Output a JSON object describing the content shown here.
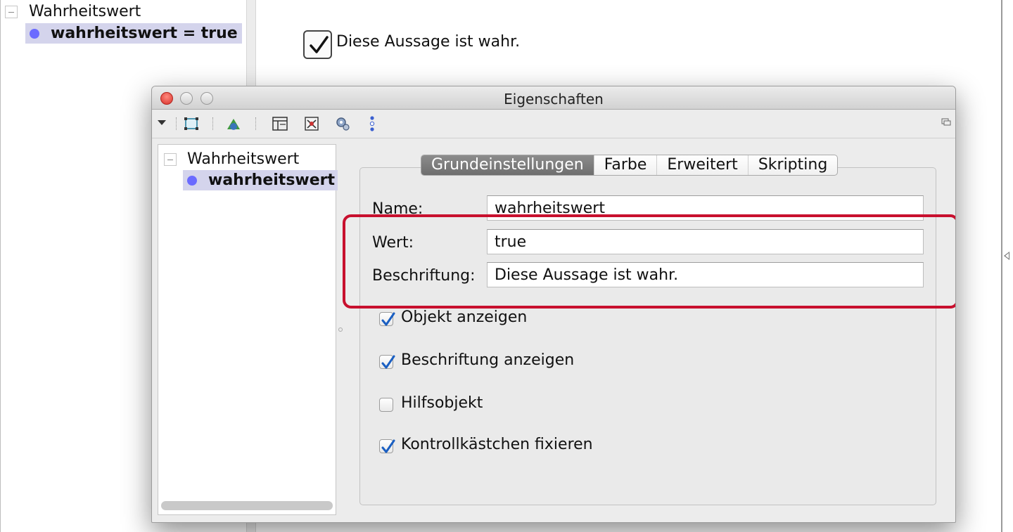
{
  "background_app": {
    "algebra": {
      "group_label": "Wahrheitswert",
      "item_label": "wahrheitswert = true"
    },
    "graphics": {
      "checkbox_caption": "Diese Aussage ist wahr.",
      "checkbox_checked": true
    }
  },
  "dialog": {
    "title": "Eigenschaften",
    "toolbar_icons": [
      "graphics-view-icon",
      "geometry-objects-icon",
      "layout-icon",
      "algebra-view-icon",
      "settings-gear-icon",
      "point-options-icon",
      "resize-corner-icon"
    ],
    "tree": {
      "group_label": "Wahrheitswert",
      "item_label": "wahrheitswert"
    },
    "tabs": [
      {
        "label": "Grundeinstellungen",
        "active": true
      },
      {
        "label": "Farbe",
        "active": false
      },
      {
        "label": "Erweitert",
        "active": false
      },
      {
        "label": "Skripting",
        "active": false
      }
    ],
    "fields": {
      "name": {
        "label": "Name:",
        "value": "wahrheitswert"
      },
      "wert": {
        "label": "Wert:",
        "value": "true"
      },
      "beschriftung": {
        "label": "Beschriftung:",
        "value": "Diese Aussage ist wahr."
      }
    },
    "checkboxes": [
      {
        "label": "Objekt anzeigen",
        "checked": true
      },
      {
        "label": "Beschriftung anzeigen",
        "checked": true
      },
      {
        "label": "Hilfsobjekt",
        "checked": false
      },
      {
        "label": "Kontrollkästchen fixieren",
        "checked": true
      }
    ]
  },
  "colors": {
    "highlight": "#c8102e",
    "selection": "#d4d4ec",
    "point": "#6b6bff",
    "checkmark": "#1a5fc2"
  }
}
